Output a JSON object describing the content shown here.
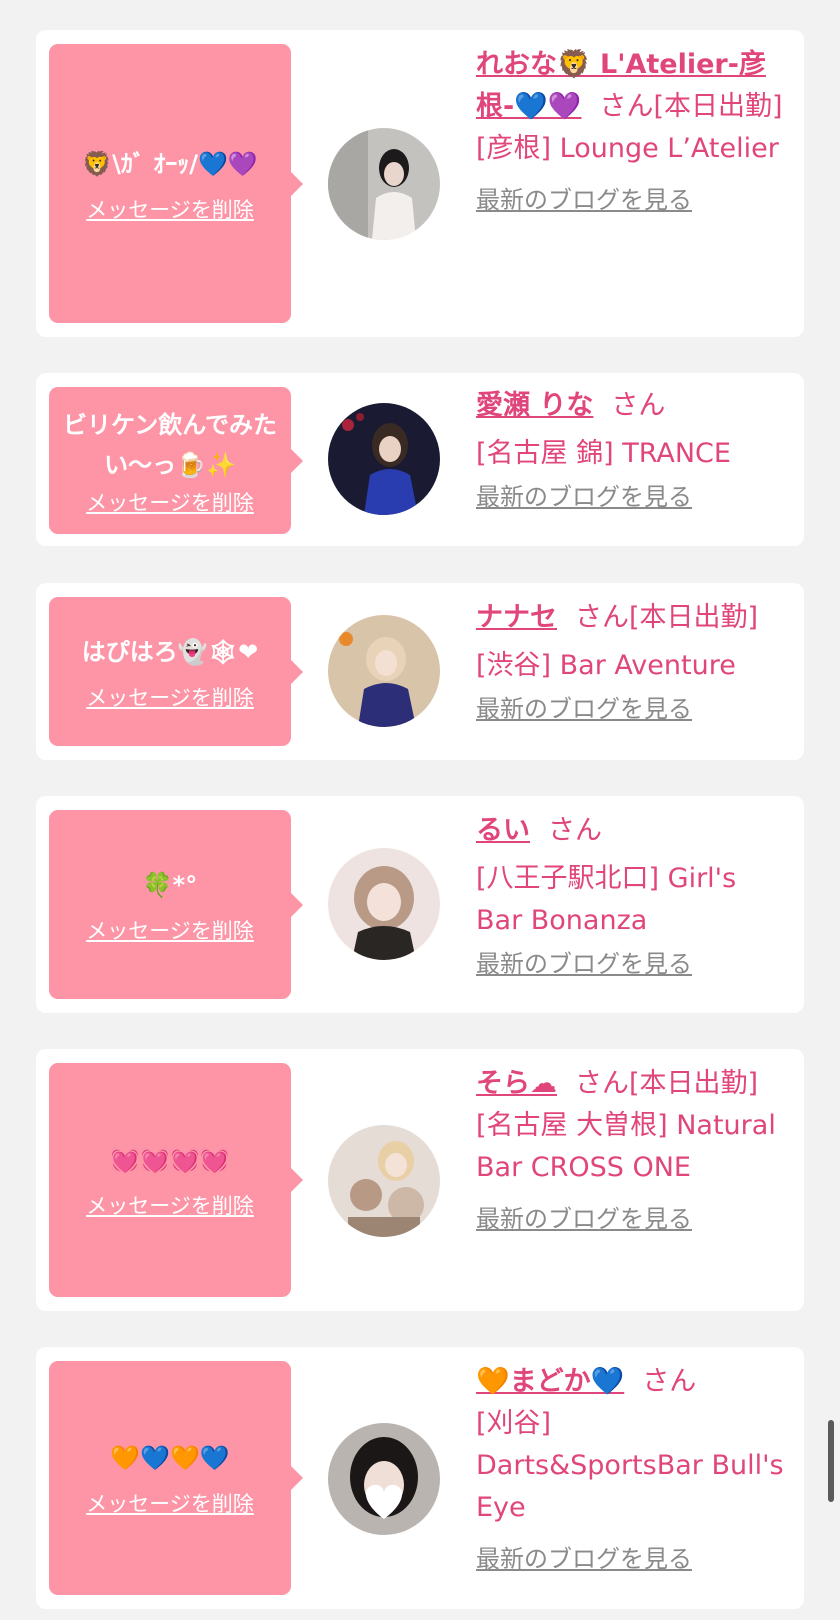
{
  "favorites": [
    {
      "message": "🦁\\ｶﾞ ｵｰｯ/💙💜",
      "delete_label": "メッセージを削除",
      "name": "れおな🦁 L'Atelier-彦根-💙💜",
      "honorific": "さん",
      "status": "[本日出勤]",
      "shop": "[彦根] Lounge L’Atelier",
      "blog_label": "最新のブログを見る",
      "avatar_color": "#b9b6b2"
    },
    {
      "message": "ビリケン飲んでみたい〜っ🍺✨",
      "delete_label": "メッセージを削除",
      "name": "愛瀬 りな",
      "honorific": "さん",
      "status": "",
      "shop": "[名古屋 錦] TRANCE",
      "blog_label": "最新のブログを見る",
      "avatar_color": "#1e1f3a"
    },
    {
      "message": "はぴはろ👻🕸❤",
      "delete_label": "メッセージを削除",
      "name": "ナナセ",
      "honorific": "さん",
      "status": "[本日出勤]",
      "shop": "[渋谷] Bar Aventure",
      "blog_label": "最新のブログを見る",
      "avatar_color": "#6b5b7a"
    },
    {
      "message": "🍀*°",
      "delete_label": "メッセージを削除",
      "name": "るい",
      "honorific": "さん",
      "status": "",
      "shop": "[八王子駅北口] Girl's Bar Bonanza",
      "blog_label": "最新のブログを見る",
      "avatar_color": "#d9c9c4"
    },
    {
      "message": "💓💓💓💓",
      "delete_label": "メッセージを削除",
      "name": "そら☁",
      "honorific": "さん",
      "status": "[本日出勤]",
      "shop": "[名古屋 大曽根] Natural Bar CROSS ONE",
      "blog_label": "最新のブログを見る",
      "avatar_color": "#d8cfc8"
    },
    {
      "message": "🧡💙🧡💙",
      "delete_label": "メッセージを削除",
      "name": "🧡まどか💙",
      "honorific": "さん",
      "status": "",
      "shop": "[刈谷] Darts&SportsBar Bull's Eye",
      "blog_label": "最新のブログを見る",
      "avatar_color": "#a9a6a4"
    }
  ],
  "colors": {
    "accent": "#e0457b",
    "bubble": "#fd95a6",
    "link_gray": "#8a8a8a",
    "background": "#f2f2f2"
  }
}
